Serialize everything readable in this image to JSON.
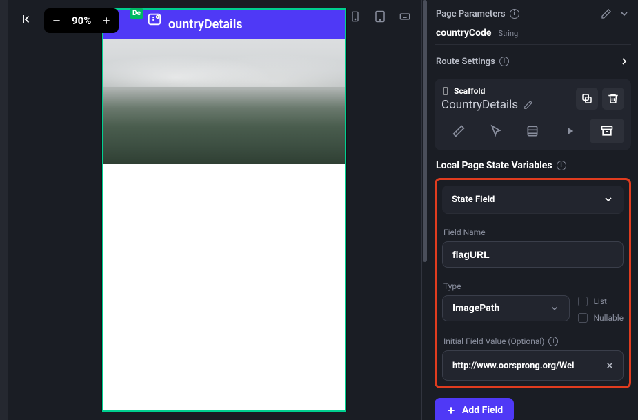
{
  "zoom": {
    "value": "90%"
  },
  "device": {
    "title": "ountryDetails"
  },
  "badge": "De",
  "panel": {
    "pageParams": {
      "title": "Page Parameters",
      "param": {
        "name": "countryCode",
        "type": "String"
      }
    },
    "route": {
      "title": "Route Settings"
    },
    "scaffold": {
      "label": "Scaffold",
      "name": "CountryDetails"
    },
    "localState": {
      "title": "Local Page State Variables",
      "stateField": {
        "header": "State Field",
        "fieldNameLabel": "Field Name",
        "fieldNameValue": "flagURL",
        "typeLabel": "Type",
        "typeValue": "ImagePath",
        "listLabel": "List",
        "nullableLabel": "Nullable",
        "initialLabel": "Initial Field Value (Optional)",
        "initialValue": "http://www.oorsprong.org/Wel"
      }
    },
    "addField": "Add Field"
  }
}
